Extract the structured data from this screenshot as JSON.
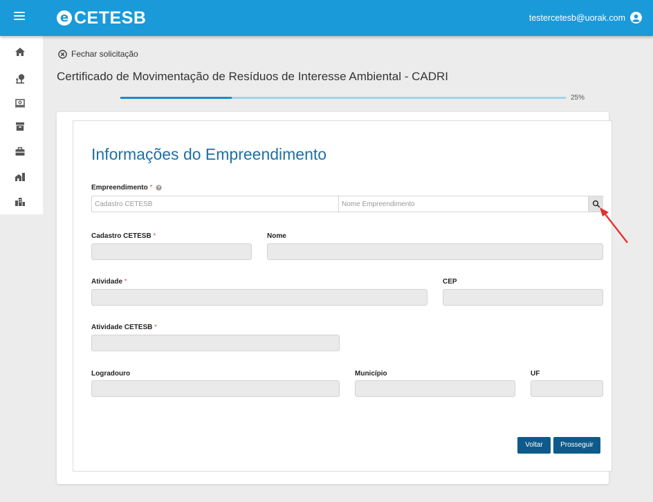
{
  "header": {
    "logo_text": "CETESB",
    "logo_mark": "e",
    "user_email": "testercetesb@uorak.com",
    "bg_color": "#1a9ad9"
  },
  "sidebar": {
    "items": [
      {
        "icon": "home-icon"
      },
      {
        "icon": "tree-icon"
      },
      {
        "icon": "monitor-icon"
      },
      {
        "icon": "archive-icon"
      },
      {
        "icon": "briefcase-icon"
      },
      {
        "icon": "building-icon"
      },
      {
        "icon": "city-icon"
      }
    ]
  },
  "page": {
    "close_label": "Fechar solicitação",
    "title": "Certificado de Movimentação de Resíduos de Interesse Ambiental - CADRI",
    "progress_value": 0.25,
    "progress_label": "25%"
  },
  "form": {
    "section_title": "Informações do Empreendimento",
    "empreendimento_label": "Empreendimento",
    "required_mark": "*",
    "search": {
      "cadastro_placeholder": "Cadastro CETESB",
      "nome_placeholder": "Nome Empreendimento"
    },
    "fields": {
      "cadastro_label": "Cadastro CETESB",
      "nome_label": "Nome",
      "atividade_label": "Atividade",
      "cep_label": "CEP",
      "atividade_cetesb_label": "Atividade CETESB",
      "logradouro_label": "Logradouro",
      "municipio_label": "Município",
      "uf_label": "UF"
    },
    "buttons": {
      "voltar": "Voltar",
      "prosseguir": "Prosseguir"
    }
  }
}
